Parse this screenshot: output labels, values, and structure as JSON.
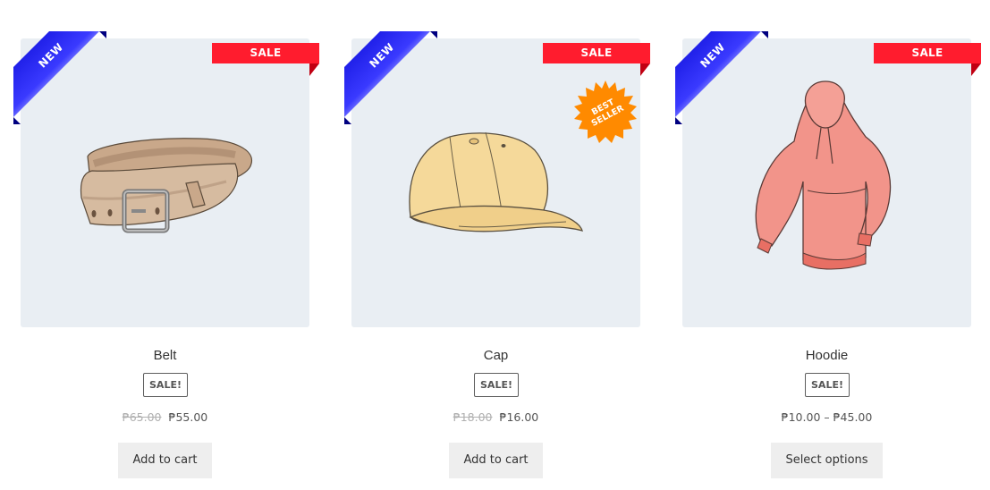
{
  "products": [
    {
      "name": "Belt",
      "ribbon": "NEW",
      "flag": "SALE",
      "badge": "SALE!",
      "price_old": "₱65.00",
      "price_new": "₱55.00",
      "button": "Add to cart",
      "image_icon": "belt-image"
    },
    {
      "name": "Cap",
      "ribbon": "NEW",
      "flag": "SALE",
      "badge": "SALE!",
      "price_old": "₱18.00",
      "price_new": "₱16.00",
      "button": "Add to cart",
      "best_seller_line1": "BEST",
      "best_seller_line2": "SELLER",
      "image_icon": "cap-image"
    },
    {
      "name": "Hoodie",
      "ribbon": "NEW",
      "flag": "SALE",
      "badge": "SALE!",
      "price_range": "₱10.00 – ₱45.00",
      "button": "Select options",
      "image_icon": "hoodie-image"
    }
  ],
  "colors": {
    "thumb_bg": "#e9eef3",
    "sale_red": "#ff1c2e",
    "ribbon_blue": "#1a1adf",
    "best_orange": "#ff8a00",
    "button_bg": "#eeeeee"
  }
}
